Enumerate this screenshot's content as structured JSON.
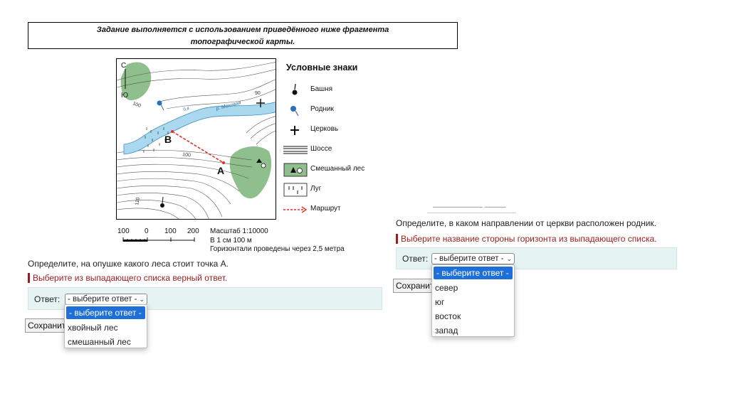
{
  "header": {
    "line1": "Задание выполняется с использованием приведённого ниже фрагмента",
    "line2": "топографической карты."
  },
  "map": {
    "compass_north": "С",
    "compass_south": "Ю",
    "label_100_top": "100",
    "label_90": "90",
    "label_100_mid": "100",
    "label_110": "110",
    "river_name": "р. Моховая",
    "river_width": "0,4",
    "point_a": "А",
    "point_b": "В"
  },
  "legend": {
    "title": "Условные знаки",
    "items": [
      {
        "label": "Башня",
        "icon": "tower-icon"
      },
      {
        "label": "Родник",
        "icon": "spring-icon"
      },
      {
        "label": "Церковь",
        "icon": "church-icon"
      },
      {
        "label": "Шоссе",
        "icon": "highway-icon"
      },
      {
        "label": "Смешанный лес",
        "icon": "mixed-forest-icon"
      },
      {
        "label": "Луг",
        "icon": "meadow-icon"
      },
      {
        "label": "Маршрут",
        "icon": "route-icon"
      }
    ]
  },
  "scale": {
    "ticks": [
      "100",
      "0",
      "100",
      "200"
    ],
    "line1": "Масштаб  1:10000",
    "line2": "В 1 см 100 м",
    "line3": "Горизонтали проведены через 2,5 метра"
  },
  "question1": {
    "text": "Определите, на опушке какого леса стоит точка А.",
    "hint": "Выберите из выпадающего списка верный ответ.",
    "answer_label": "Ответ:",
    "select_value": "- выберите ответ -",
    "options": [
      "- выберите ответ -",
      "хвойный лес",
      "смешанный лес"
    ],
    "save_label": "Сохранить"
  },
  "question2": {
    "fragment_text": "——————— ———",
    "text": "Определите, в каком направлении от церкви расположен родник.",
    "hint": "Выберите название стороны горизонта из выпадающего списка.",
    "answer_label": "Ответ:",
    "select_value": "- выберите ответ -",
    "options": [
      "- выберите ответ -",
      "север",
      "юг",
      "восток",
      "запад"
    ],
    "save_label": "Сохранить"
  },
  "colors": {
    "river": "#a9d8ef",
    "forest": "#8fbf8c",
    "route": "#e0302a",
    "hint": "#9b1c1c",
    "option_selected": "#1f6fd8",
    "answer_panel": "#e6f3f3"
  }
}
